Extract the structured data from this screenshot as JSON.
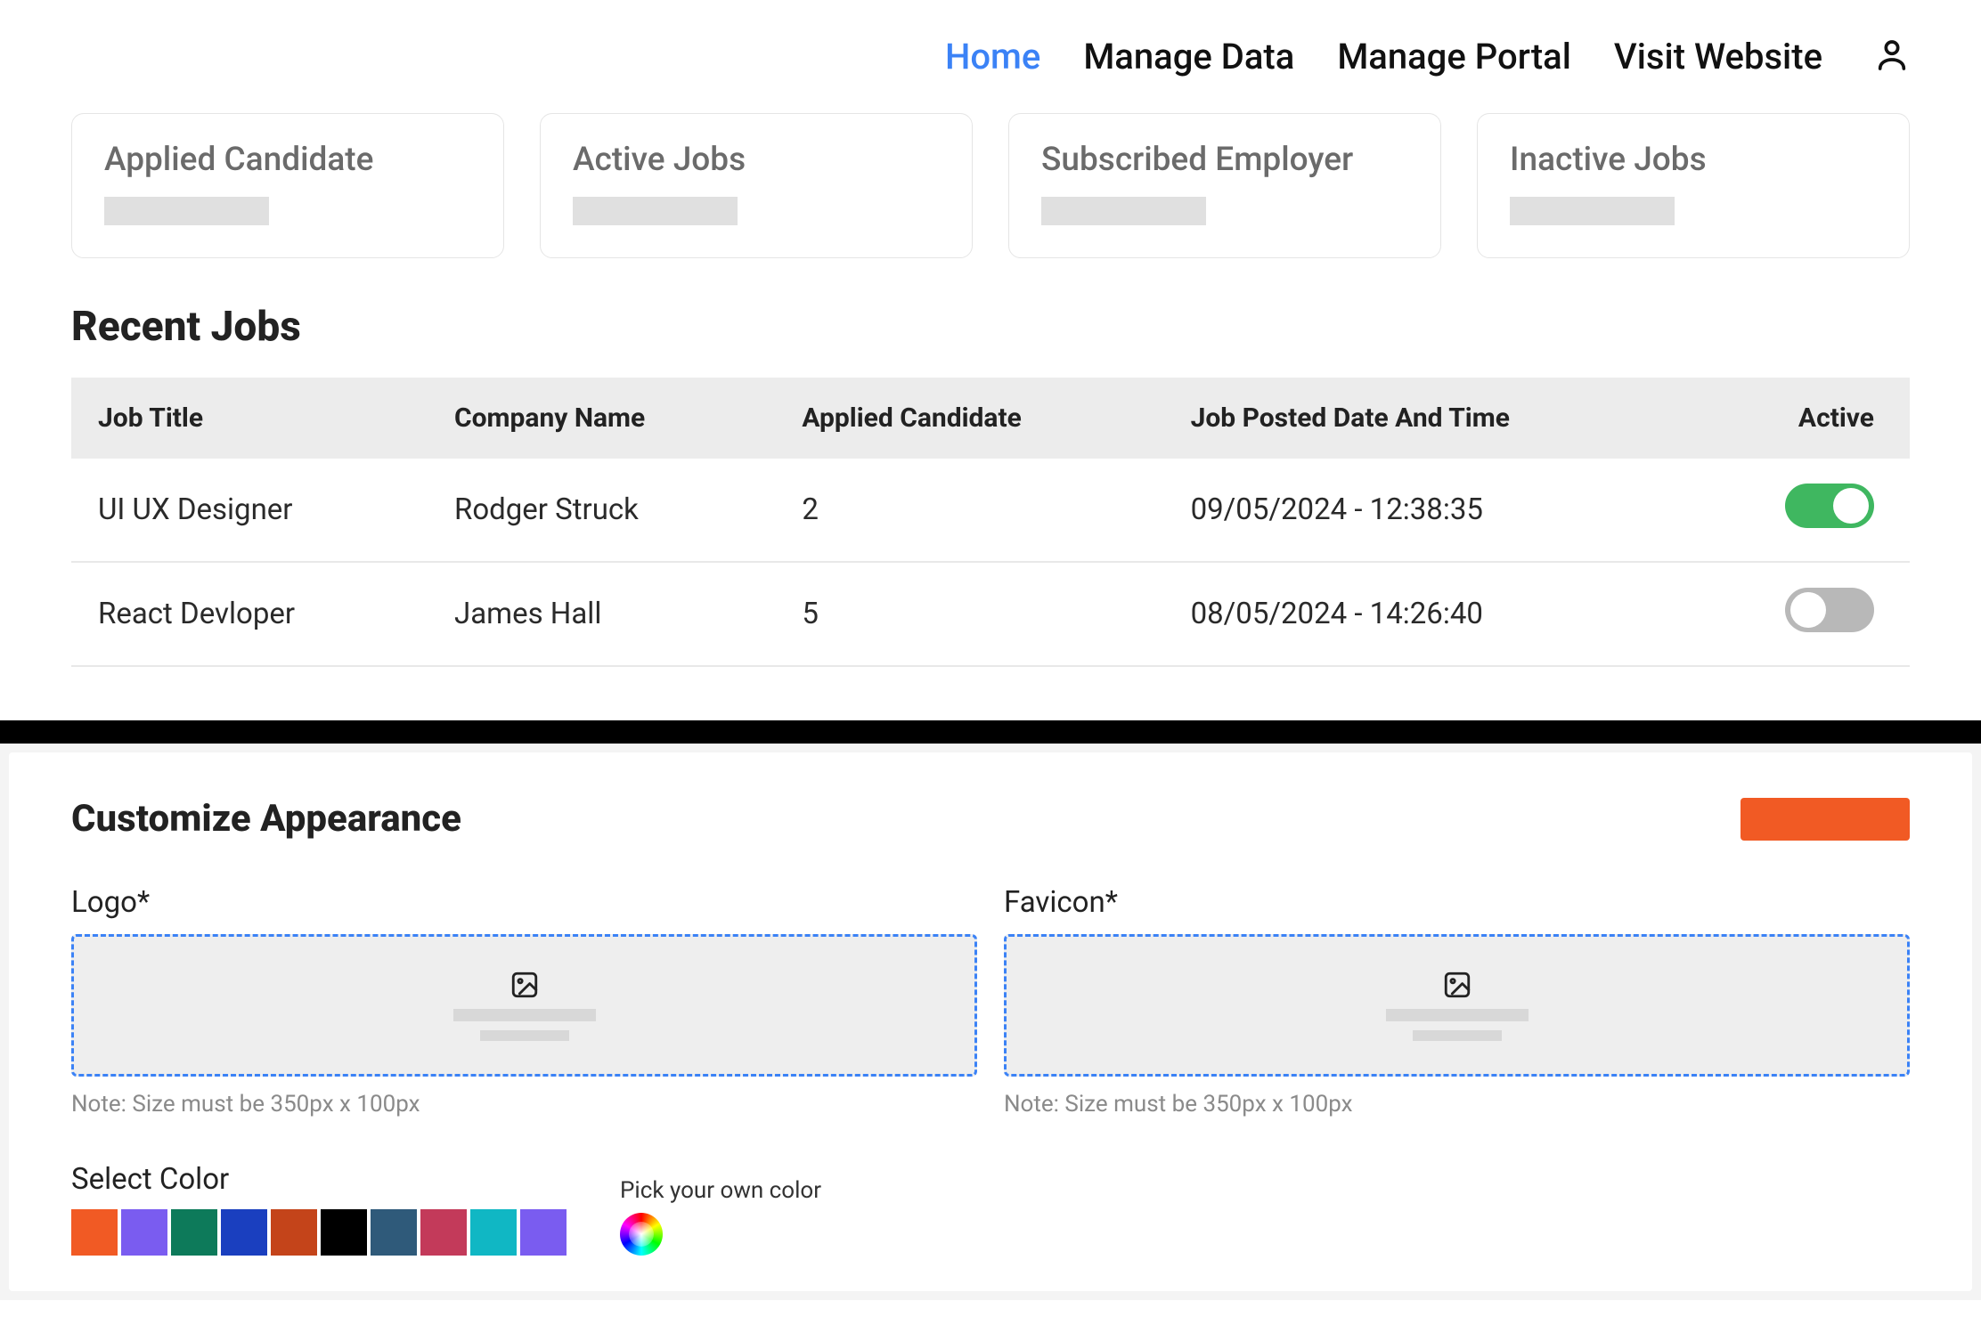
{
  "nav": {
    "items": [
      {
        "label": "Home",
        "active": true
      },
      {
        "label": "Manage Data",
        "active": false
      },
      {
        "label": "Manage Portal",
        "active": false
      },
      {
        "label": "Visit Website",
        "active": false
      }
    ]
  },
  "stats": [
    {
      "label": "Applied Candidate"
    },
    {
      "label": "Active Jobs"
    },
    {
      "label": "Subscribed Employer"
    },
    {
      "label": "Inactive Jobs"
    }
  ],
  "recent_jobs": {
    "title": "Recent Jobs",
    "columns": [
      "Job Title",
      "Company Name",
      "Applied Candidate",
      "Job Posted Date And Time",
      "Active"
    ],
    "rows": [
      {
        "title": "UI UX Designer",
        "company": "Rodger Struck",
        "applied": "2",
        "posted": "09/05/2024 - 12:38:35",
        "active": true
      },
      {
        "title": "React Devloper",
        "company": "James Hall",
        "applied": "5",
        "posted": "08/05/2024 - 14:26:40",
        "active": false
      }
    ]
  },
  "appearance": {
    "title": "Customize Appearance",
    "logo_label": "Logo*",
    "favicon_label": "Favicon*",
    "logo_note": "Note: Size must be 350px x 100px",
    "favicon_note": "Note: Size must be 350px x 100px",
    "select_color_label": "Select Color",
    "pick_own_label": "Pick your own color",
    "swatches": [
      "#f15a24",
      "#7a5cf0",
      "#0d7a5a",
      "#1a3fbf",
      "#c4441a",
      "#000000",
      "#2f5a7a",
      "#c33a5a",
      "#10b7c4",
      "#7a5cf0"
    ]
  }
}
